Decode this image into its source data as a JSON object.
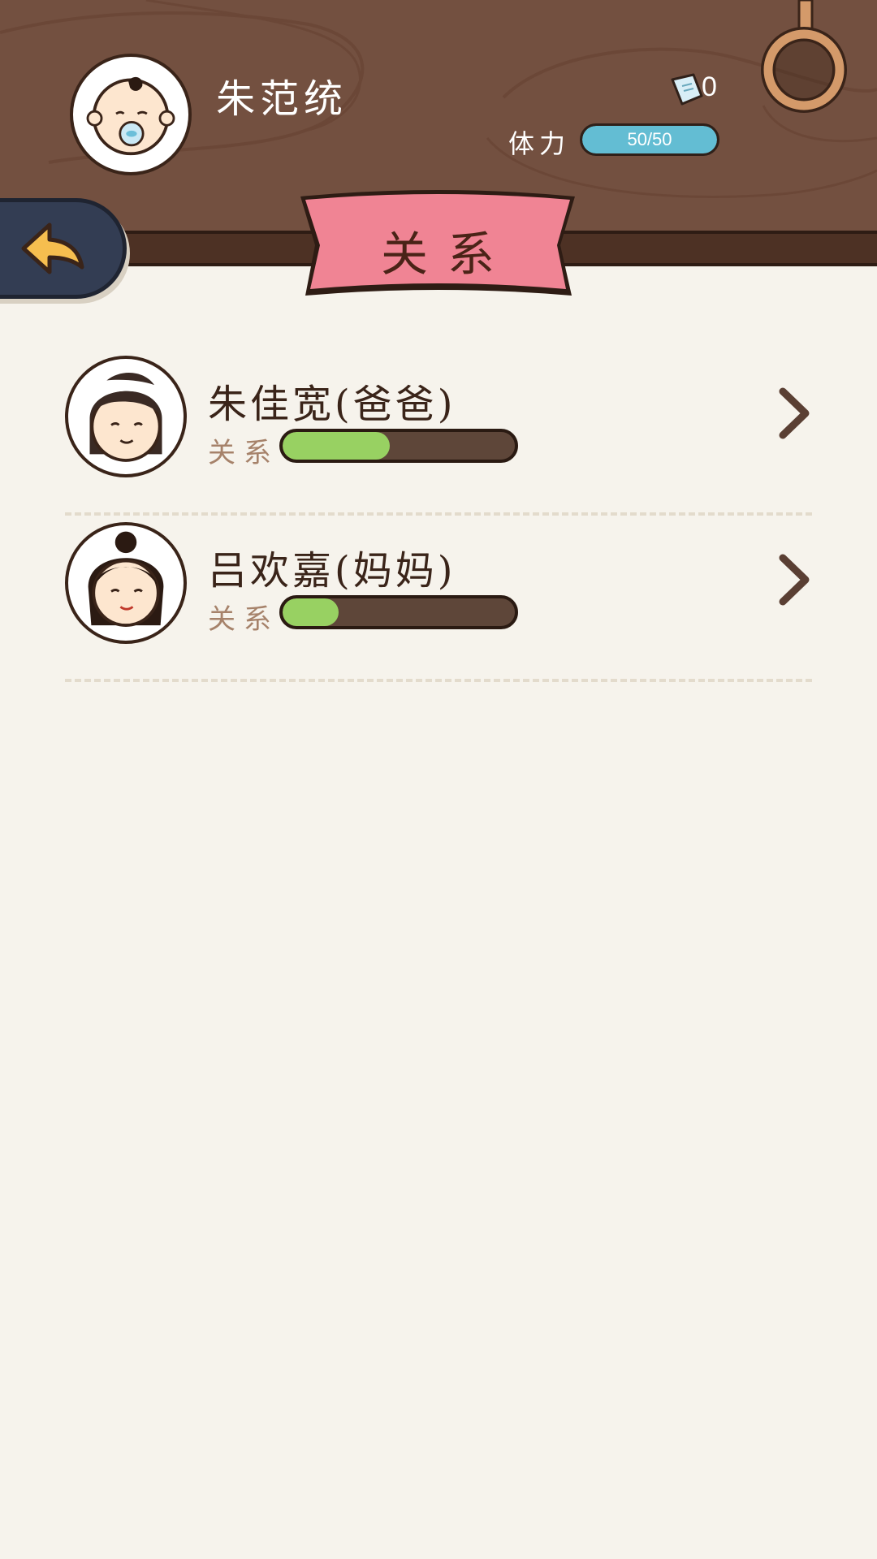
{
  "header": {
    "player_name": "朱范统",
    "ticket_count": "0",
    "stamina_label": "体力",
    "stamina_text": "50/50",
    "stamina_fraction": 1.0
  },
  "page": {
    "title": "关系"
  },
  "relations": [
    {
      "name": "朱佳宽(爸爸)",
      "rel_label": "关系",
      "level_fraction": 0.46
    },
    {
      "name": "吕欢嘉(妈妈)",
      "rel_label": "关系",
      "level_fraction": 0.24
    }
  ],
  "colors": {
    "wood": "#735040",
    "ribbon": "#f08494",
    "stamina": "#63bdd3",
    "relation_fill": "#98d162",
    "back_button": "#333d53",
    "back_arrow": "#f6be4f"
  },
  "icons": {
    "back": "arrow-left-icon",
    "ticket": "ticket-icon",
    "settings": "ring-icon",
    "row_arrow": "chevron-right-icon"
  }
}
